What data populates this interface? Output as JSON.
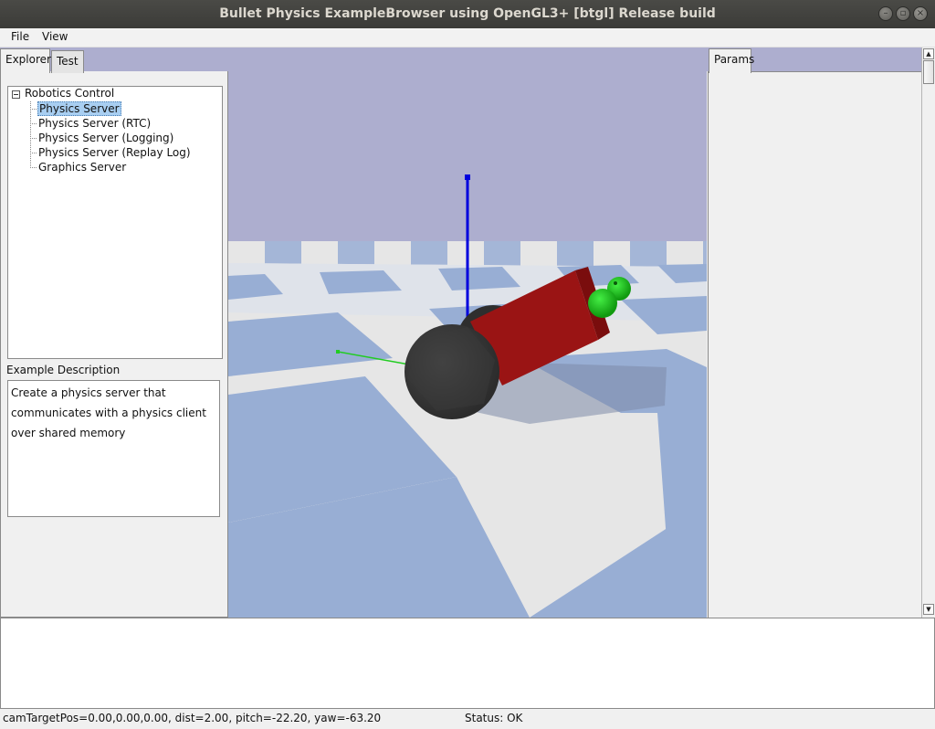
{
  "window": {
    "title": "Bullet Physics ExampleBrowser using OpenGL3+ [btgl] Release build"
  },
  "menubar": {
    "items": [
      "File",
      "View"
    ]
  },
  "left_panel": {
    "tabs": [
      "Explorer",
      "Test"
    ],
    "active_tab": "Explorer",
    "tree": {
      "root_label": "Robotics Control",
      "root_expanded": true,
      "items": [
        {
          "label": "Physics Server",
          "selected": true
        },
        {
          "label": "Physics Server (RTC)",
          "selected": false
        },
        {
          "label": "Physics Server (Logging)",
          "selected": false
        },
        {
          "label": "Physics Server (Replay Log)",
          "selected": false
        },
        {
          "label": "Graphics Server",
          "selected": false
        }
      ]
    },
    "description_label": "Example Description",
    "description_lines": [
      "Create a physics server that",
      "communicates with a physics client",
      "over shared memory"
    ]
  },
  "right_panel": {
    "tabs": [
      "Params"
    ],
    "active_tab": "Params"
  },
  "viewport": {
    "sky_color": "#adaecf",
    "floor_light_color": "#e6e6e6",
    "floor_dark_color": "#98aed4",
    "axis_x_color": "#22cc22",
    "axis_z_color": "#0000dd",
    "robot_body_color": "#9a1414",
    "wheel_color": "#3a3a3a",
    "head_color": "#22cc22"
  },
  "status": {
    "camera": "camTargetPos=0.00,0.00,0.00, dist=2.00, pitch=-22.20, yaw=-63.20",
    "text": "Status: OK"
  }
}
